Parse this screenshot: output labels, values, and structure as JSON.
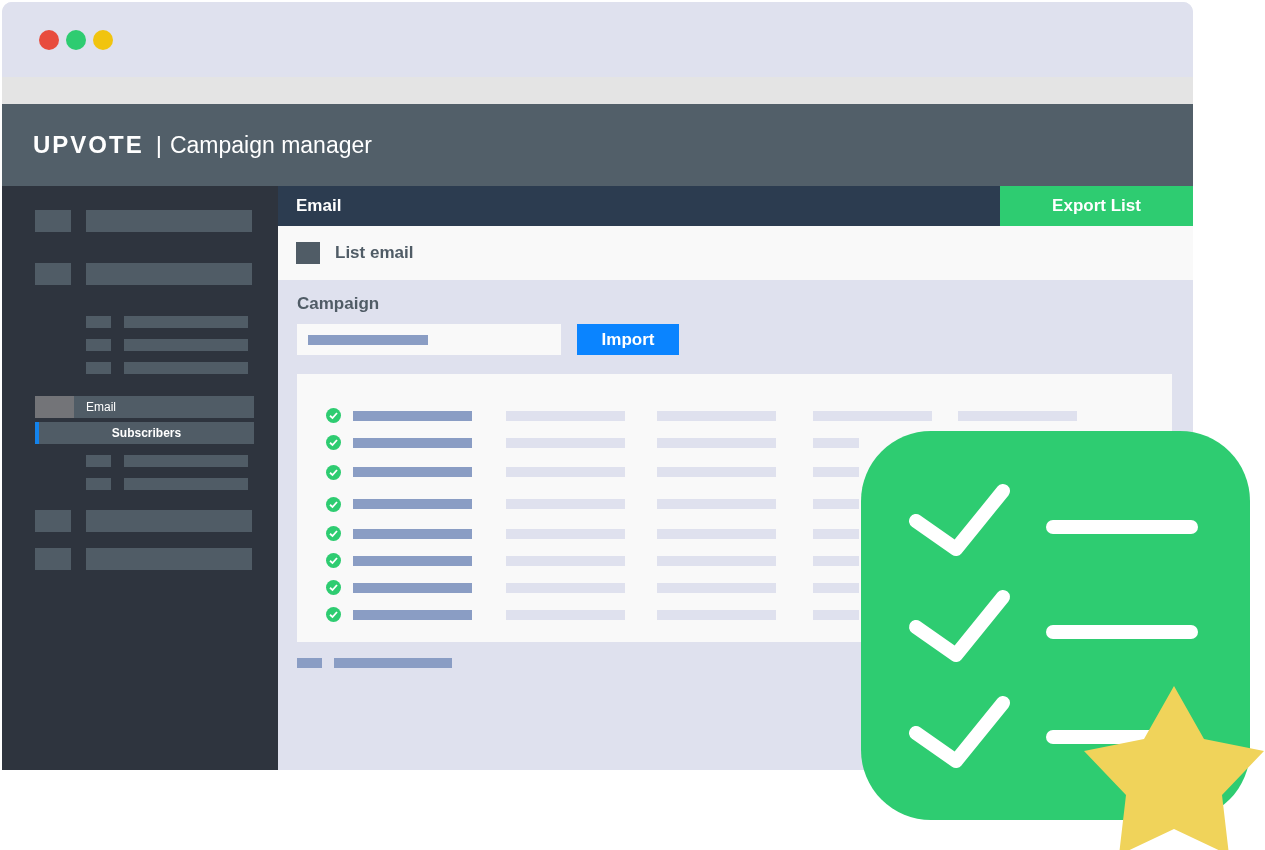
{
  "window": {
    "controls": [
      {
        "color": "#e84c3d"
      },
      {
        "color": "#2ecc71"
      },
      {
        "color": "#f1c40f"
      }
    ]
  },
  "header": {
    "logo": "UPVOTE",
    "separator": "|",
    "title": "Campaign manager"
  },
  "sidebar": {
    "items": [
      {
        "label": "Email",
        "kind": "parent",
        "selected": false
      },
      {
        "label": "Subscribers",
        "kind": "child",
        "selected": true
      }
    ]
  },
  "topbar": {
    "title": "Email",
    "button": "Export List"
  },
  "subheader": {
    "title": "List email"
  },
  "campaign": {
    "label": "Campaign",
    "button": "Import"
  },
  "table": {
    "rows": [
      {
        "checked": true
      },
      {
        "checked": true
      },
      {
        "checked": true
      },
      {
        "checked": true
      },
      {
        "checked": true
      },
      {
        "checked": true
      },
      {
        "checked": true
      },
      {
        "checked": true
      }
    ]
  }
}
